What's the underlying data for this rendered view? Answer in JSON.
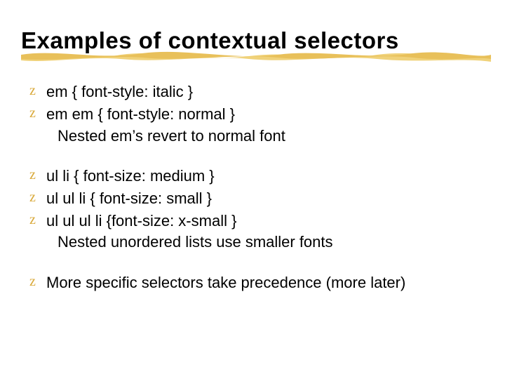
{
  "title": "Examples of contextual selectors",
  "group1": {
    "b1": "em { font-style: italic }",
    "b2": "em em { font-style: normal }",
    "b2sub": "Nested em’s revert to normal font"
  },
  "group2": {
    "b1": "ul li { font-size: medium }",
    "b2": "ul ul li { font-size: small }",
    "b3": "ul ul ul li {font-size: x-small }",
    "b3sub": "Nested unordered lists use smaller fonts"
  },
  "group3": {
    "b1": "More specific selectors take precedence (more later)"
  },
  "bullet_glyph": "z",
  "colors": {
    "accent": "#d9a93a",
    "underline1": "#e8c05a",
    "underline2": "#f0d27a"
  }
}
